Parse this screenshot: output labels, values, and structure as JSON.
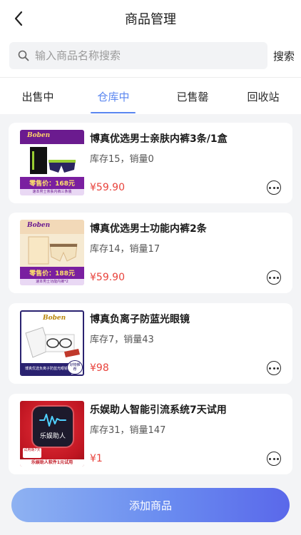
{
  "header": {
    "title": "商品管理"
  },
  "search": {
    "placeholder": "输入商品名称搜索",
    "button": "搜索"
  },
  "tabs": [
    {
      "label": "出售中",
      "active": false
    },
    {
      "label": "仓库中",
      "active": true
    },
    {
      "label": "已售罄",
      "active": false
    },
    {
      "label": "回收站",
      "active": false
    }
  ],
  "products": [
    {
      "name": "博真优选男士亲肤内裤3条/1盒",
      "stock_sales": "库存15，销量0",
      "price": "¥59.90",
      "thumb": {
        "brand": "Boben",
        "promo": "零售价：168元",
        "sub": "速本男士亲肤内裤三条装"
      }
    },
    {
      "name": "博真优选男士功能内裤2条",
      "stock_sales": "库存14，销量17",
      "price": "¥59.90",
      "thumb": {
        "brand": "Boben",
        "promo": "零售价：188元",
        "sub": "速本男士功能内裤*2"
      }
    },
    {
      "name": "博真负离子防蓝光眼镜",
      "stock_sales": "库存7，销量43",
      "price": "¥98",
      "thumb": {
        "brand": "Boben",
        "caption": "博真优选负离子防蓝光眼镜",
        "badge": "好物推荐"
      }
    },
    {
      "name": "乐娱助人智能引流系统7天试用",
      "stock_sales": "库存31，销量147",
      "price": "¥1",
      "thumb": {
        "logo_text": "乐娱助人",
        "trial": "试用期7天",
        "caption": "乐娱助人软件1元试用"
      }
    }
  ],
  "add_button": "添加商品",
  "colors": {
    "accent": "#5a86f0",
    "price": "#e8433c",
    "button_start": "#8eb2f2",
    "button_end": "#5a68ea"
  }
}
